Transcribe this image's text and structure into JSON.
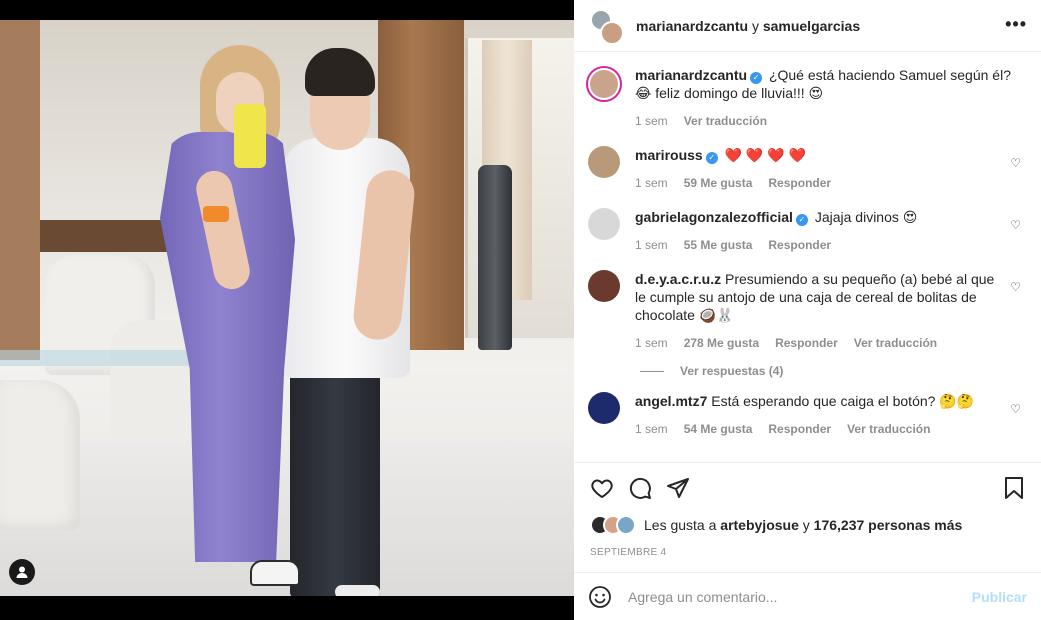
{
  "colors": {
    "accent": "#0095f6",
    "verified": "#3897f0",
    "heart": "#ed4956",
    "publish_disabled": "#b2dffc"
  },
  "header": {
    "user1": "marianardzcantu",
    "connector": "y",
    "user2": "samuelgarcias",
    "more_icon": "more-horizontal-icon"
  },
  "caption": {
    "user": "marianardzcantu",
    "text": "¿Qué está haciendo Samuel según él? 😂 feliz domingo de lluvia!!! 😍",
    "time": "1 sem",
    "translate": "Ver traducción"
  },
  "comments": [
    {
      "user": "marirouss",
      "verified": true,
      "text": "❤️ ❤️ ❤️ ❤️",
      "time": "1 sem",
      "likes": "59 Me gusta",
      "reply": "Responder",
      "translate": ""
    },
    {
      "user": "gabrielagonzalezofficial",
      "verified": true,
      "text": "Jajaja divinos 😍",
      "time": "1 sem",
      "likes": "55 Me gusta",
      "reply": "Responder",
      "translate": ""
    },
    {
      "user": "d.e.y.a.c.r.u.z",
      "verified": false,
      "text": "Presumiendo a su pequeño (a) bebé al que le cumple su antojo de una caja de cereal de bolitas de chocolate 🥥🐰",
      "time": "1 sem",
      "likes": "278 Me gusta",
      "reply": "Responder",
      "translate": "Ver traducción",
      "view_replies": "Ver respuestas (4)"
    },
    {
      "user": "angel.mtz7",
      "verified": false,
      "text": "Está esperando que caiga el botón? 🤔🤔",
      "time": "1 sem",
      "likes": "54 Me gusta",
      "reply": "Responder",
      "translate": "Ver traducción"
    }
  ],
  "actions": {
    "like_icon": "heart-icon",
    "comment_icon": "comment-icon",
    "share_icon": "send-icon",
    "save_icon": "bookmark-icon"
  },
  "likes": {
    "prefix": "Les gusta a",
    "user": "artebyjosue",
    "connector": "y",
    "count": "176,237 personas más"
  },
  "date": "SEPTIEMBRE 4",
  "add_comment": {
    "placeholder": "Agrega un comentario...",
    "publish": "Publicar"
  }
}
